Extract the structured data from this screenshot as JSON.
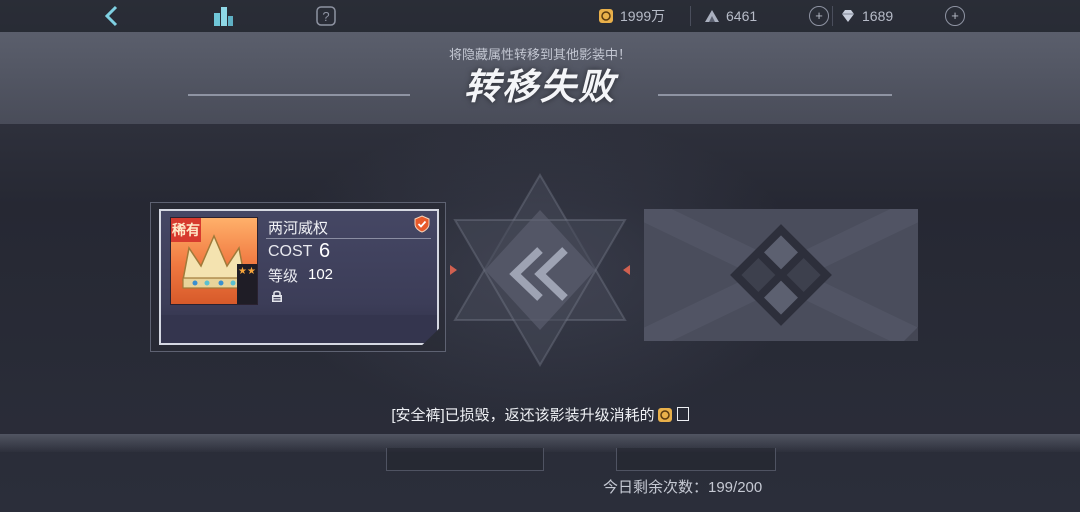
{
  "topbar": {
    "back_icon": "back-arrow-icon",
    "city_icon": "city-buildings-icon",
    "help_icon": "question-mark-icon",
    "coins": {
      "icon": "coin-icon",
      "value": "1999万"
    },
    "energy": {
      "icon": "mountain-energy-icon",
      "value": "6461"
    },
    "gems": {
      "icon": "diamond-icon",
      "value": "1689"
    }
  },
  "header": {
    "subtitle": "将隐藏属性转移到其他影装中！",
    "title": "转移失败"
  },
  "card": {
    "rarity_tag": "稀有",
    "name": "两河威权",
    "cost_label": "COST",
    "cost_value": "6",
    "level_label": "等级",
    "level_value": "102",
    "stars": "★★"
  },
  "notice": {
    "text": "[安全裤]已损毁，返还该影装升级消耗的"
  },
  "footer": {
    "remaining_label": "今日剩余次数：199/200"
  },
  "colors": {
    "background": "#2a2d38",
    "header_band": "#6a6e7e",
    "card_bg": "#454764",
    "rarity_red": "#d73a2e",
    "shield_orange": "#e85a2a"
  }
}
